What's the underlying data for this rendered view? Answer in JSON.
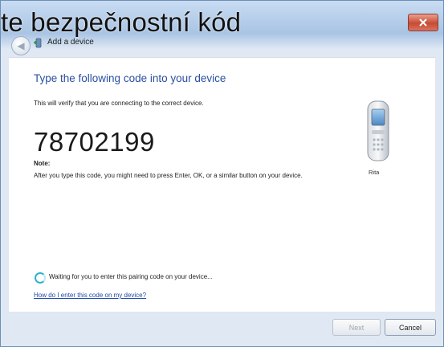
{
  "caption": "te bezpečnostní kód",
  "window": {
    "title": "Add a device",
    "close_icon": "close-icon",
    "back_icon": "back-arrow-icon"
  },
  "main": {
    "heading": "Type the following code into your device",
    "subtext": "This will verify that you are connecting to the correct device.",
    "code": "78702199",
    "note_label": "Note:",
    "note_text": "After you type this code, you might need to press Enter, OK, or a similar button on your device.",
    "device_name": "Rita",
    "device_icon": "mobile-phone-icon",
    "waiting_text": "Waiting for you to enter this pairing code on your device...",
    "help_link": "How do I enter this code on my device?"
  },
  "buttons": {
    "next": "Next",
    "cancel": "Cancel"
  },
  "colors": {
    "heading": "#2a4fa3",
    "link": "#1f4aa8",
    "spinner": "#2fb2c9",
    "close_button": "#c74b33"
  }
}
